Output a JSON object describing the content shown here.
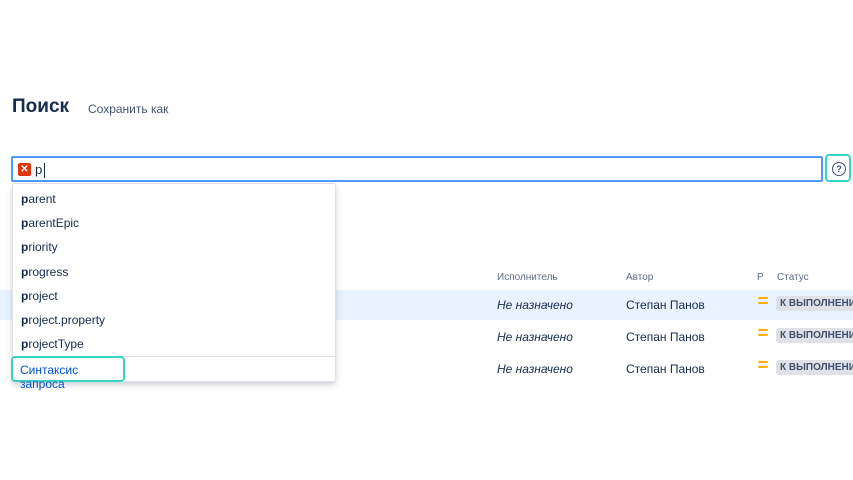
{
  "header": {
    "title": "Поиск",
    "save_as": "Сохранить как"
  },
  "search": {
    "query": "p",
    "error_icon": "error-x-icon",
    "help_icon": "question-circle-icon"
  },
  "suggestions": {
    "items": [
      {
        "match": "p",
        "rest": "arent"
      },
      {
        "match": "p",
        "rest": "arentEpic"
      },
      {
        "match": "p",
        "rest": "riority"
      },
      {
        "match": "p",
        "rest": "rogress"
      },
      {
        "match": "p",
        "rest": "roject"
      },
      {
        "match": "p",
        "rest": "roject.property"
      },
      {
        "match": "p",
        "rest": "rojectType"
      }
    ],
    "syntax_link": "Синтаксис запроса"
  },
  "table": {
    "columns": {
      "assignee": "Исполнитель",
      "author": "Автор",
      "priority": "Р",
      "status": "Статус"
    },
    "rows": [
      {
        "assignee": "Не назначено",
        "author": "Степан Панов",
        "priority": "medium",
        "status": "К ВЫПОЛНЕНИЮ"
      },
      {
        "assignee": "Не назначено",
        "author": "Степан Панов",
        "priority": "medium",
        "status": "К ВЫПОЛНЕНИЮ"
      },
      {
        "assignee": "Не назначено",
        "author": "Степан Панов",
        "priority": "medium",
        "status": "К ВЫПОЛНЕНИЮ"
      }
    ]
  },
  "colors": {
    "focus_border": "#4c9aff",
    "highlight_outline": "#39d3c4",
    "priority_medium": "#ffab00",
    "link": "#0052cc"
  }
}
